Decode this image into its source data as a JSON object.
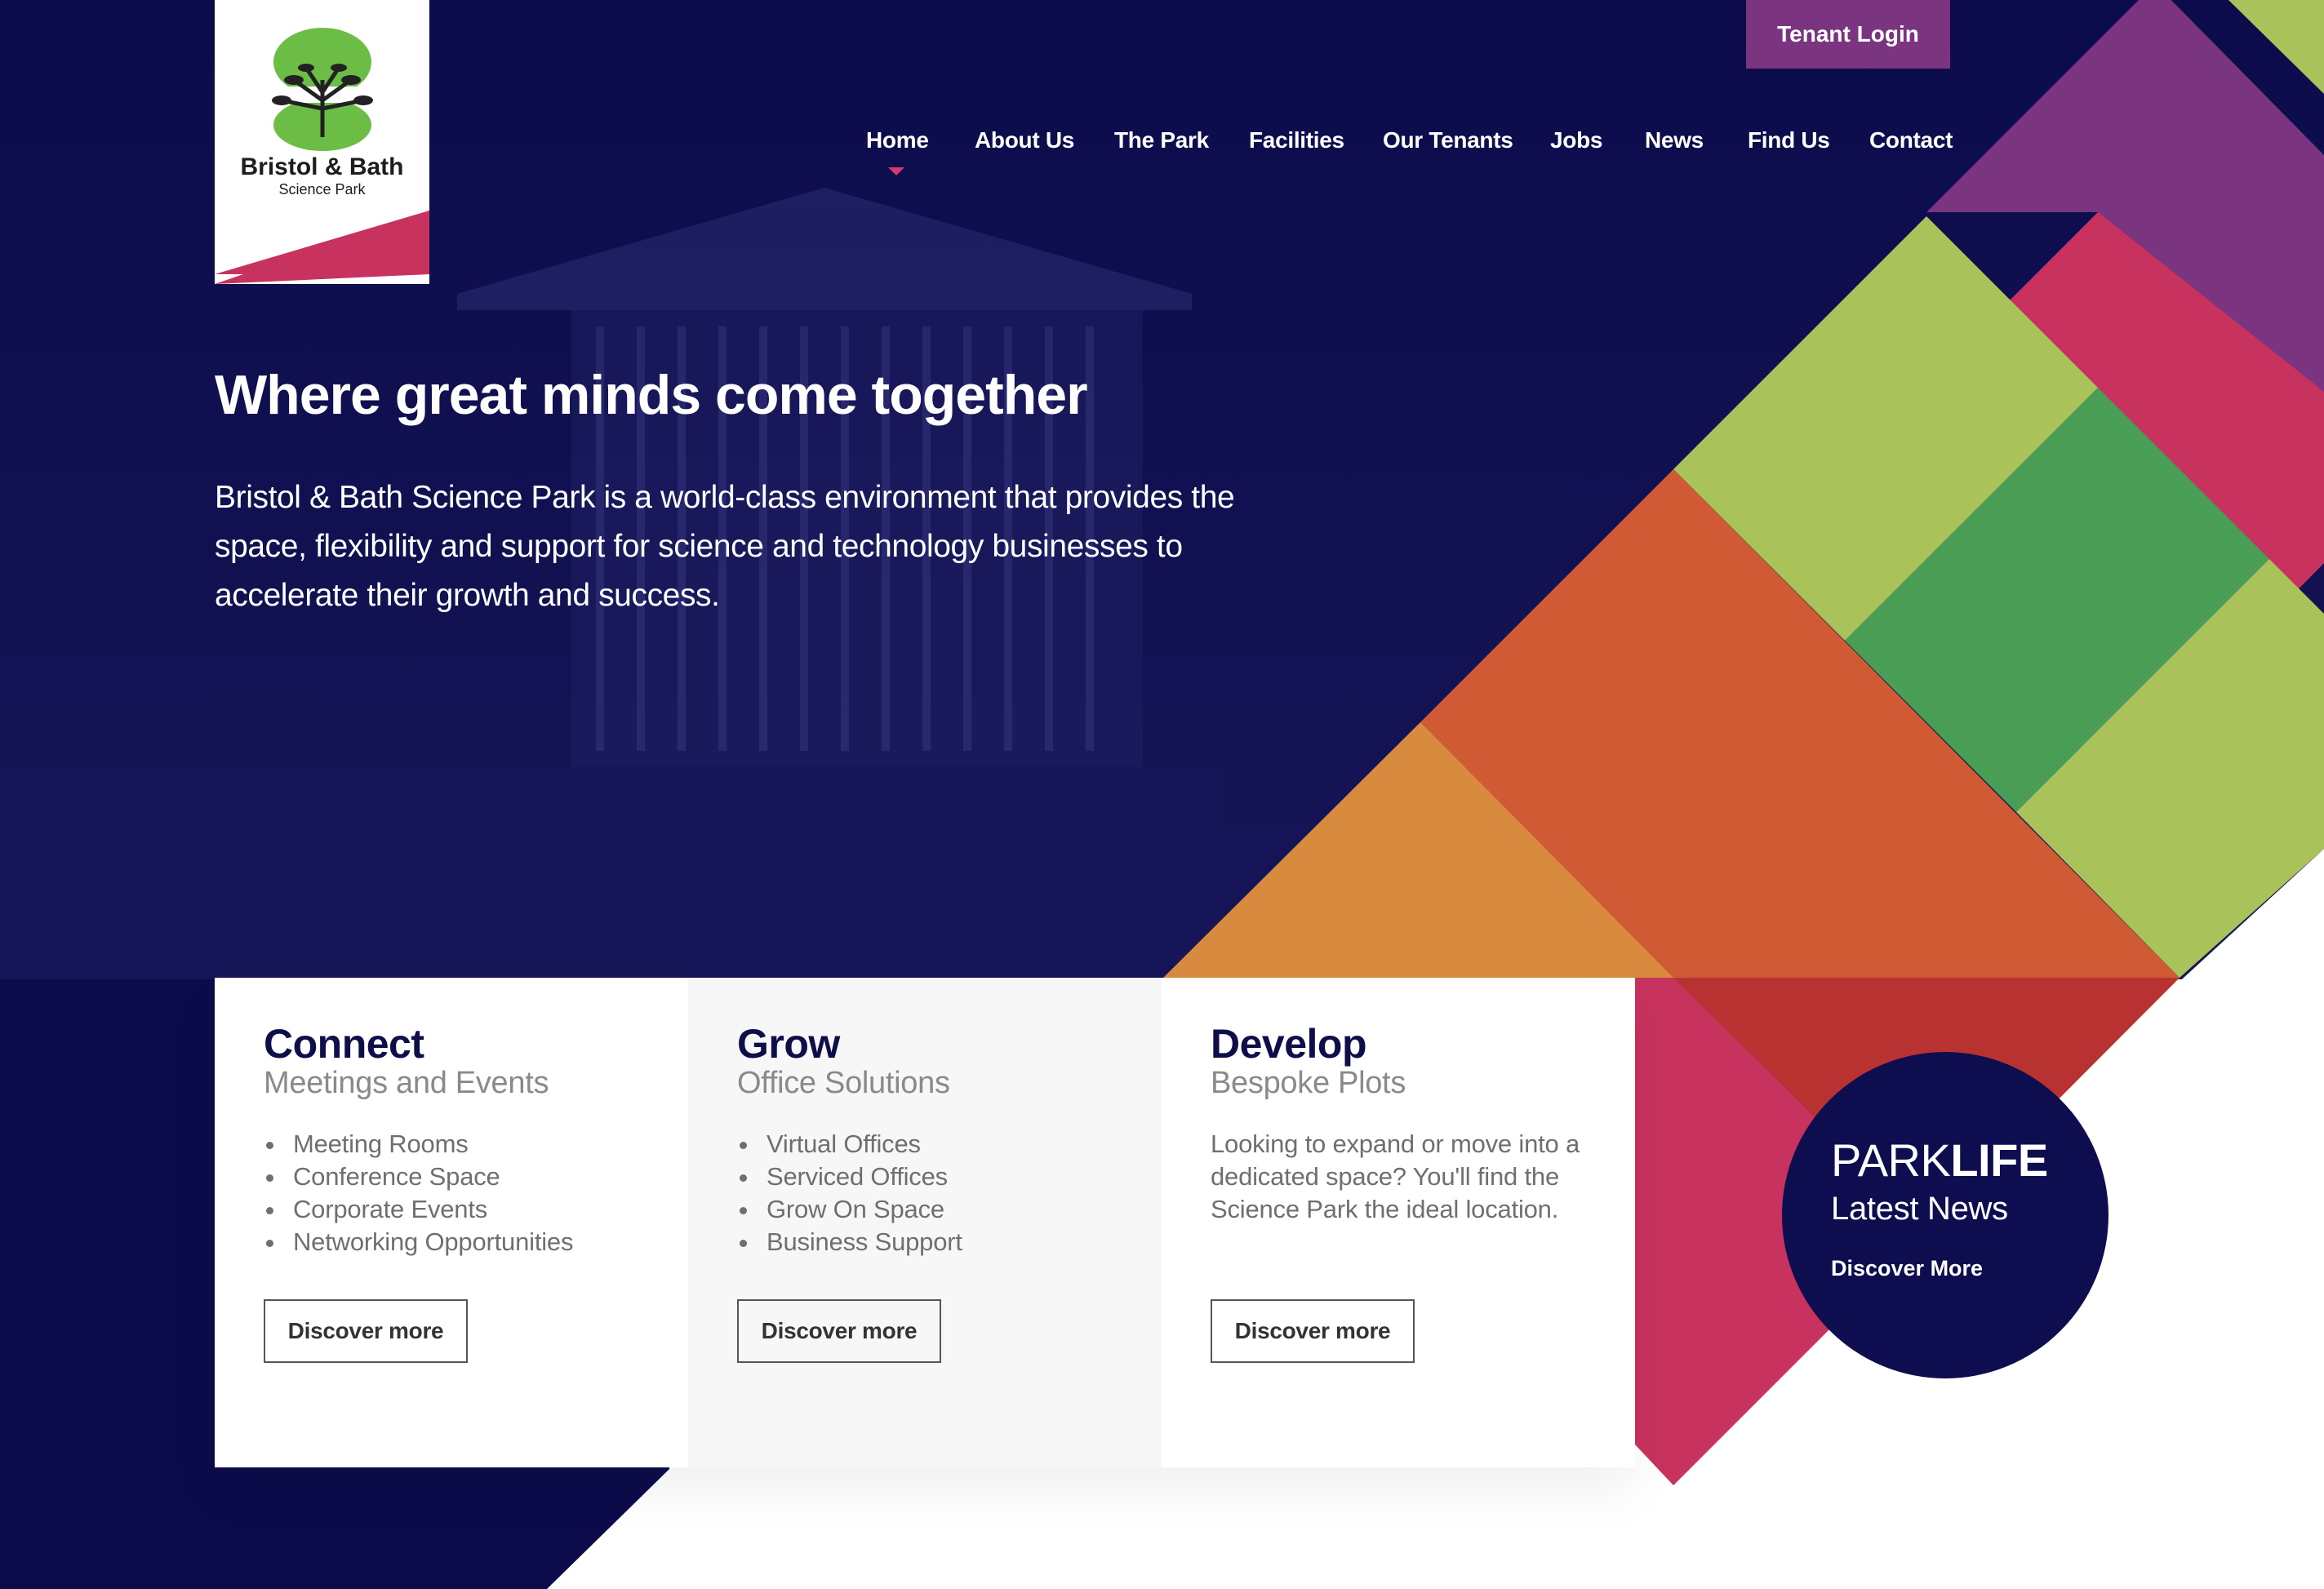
{
  "logo": {
    "name": "Bristol & Bath",
    "subtitle": "Science Park"
  },
  "header": {
    "tenant_login": "Tenant Login"
  },
  "nav": {
    "items": [
      {
        "label": "Home",
        "active": true
      },
      {
        "label": "About Us"
      },
      {
        "label": "The Park"
      },
      {
        "label": "Facilities"
      },
      {
        "label": "Our Tenants"
      },
      {
        "label": "Jobs"
      },
      {
        "label": "News"
      },
      {
        "label": "Find Us"
      },
      {
        "label": "Contact"
      }
    ]
  },
  "hero": {
    "title": "Where great minds come together",
    "text": "Bristol & Bath Science Park is a world-class environment that provides the space, flexibility and support for science and technology businesses to accelerate their growth and success."
  },
  "cards": [
    {
      "title": "Connect",
      "subtitle": "Meetings and Events",
      "items": [
        "Meeting Rooms",
        "Conference Space",
        "Corporate Events",
        "Networking Opportunities"
      ],
      "button": "Discover more"
    },
    {
      "title": "Grow",
      "subtitle": "Office Solutions",
      "items": [
        "Virtual Offices",
        "Serviced Offices",
        "Grow On Space",
        "Business Support"
      ],
      "button": "Discover more"
    },
    {
      "title": "Develop",
      "subtitle": "Bespoke Plots",
      "text": "Looking to expand or move into a dedicated space? You'll find the Science Park the ideal location.",
      "button": "Discover more"
    }
  ],
  "parklife": {
    "title_light": "PARK",
    "title_bold": "LIFE",
    "subtitle": "Latest News",
    "link": "Discover More"
  },
  "colors": {
    "navy": "#0d0d4f",
    "magenta": "#c8325f",
    "purple": "#7a3480",
    "lime": "#a9c35a",
    "green": "#4a9d55",
    "orange": "#cf5a34",
    "amber": "#d88a3e",
    "red": "#b93232"
  }
}
